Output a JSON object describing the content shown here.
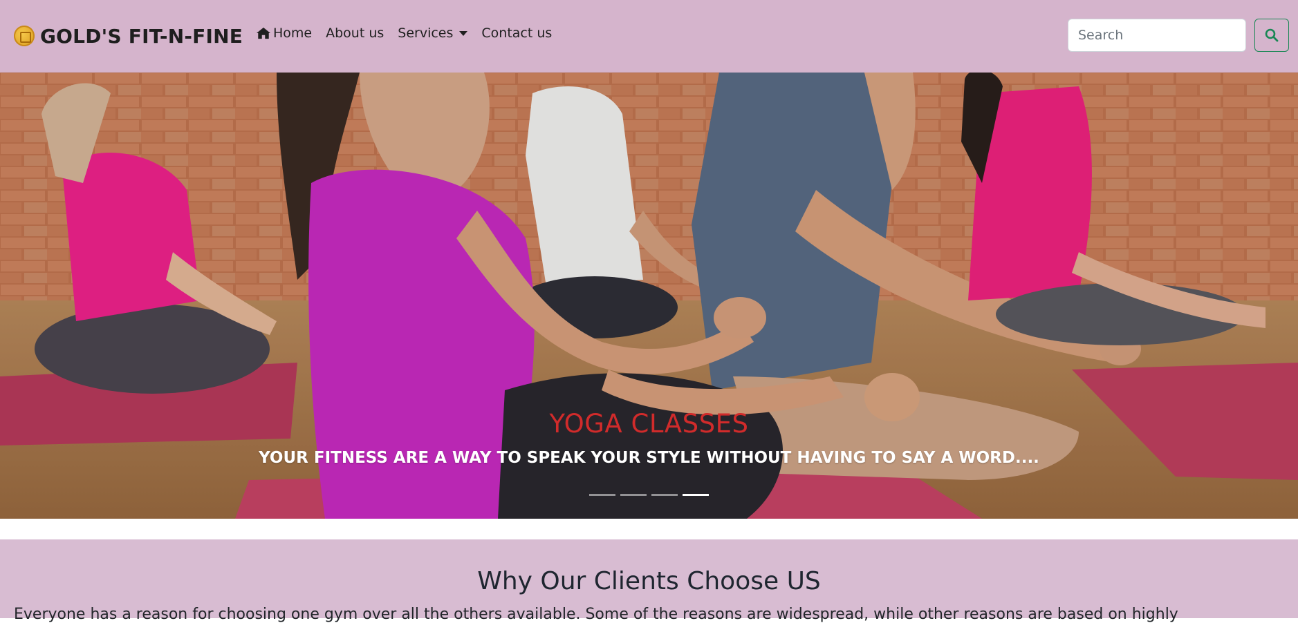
{
  "navbar": {
    "brand": "GOLD'S FIT-N-FINE",
    "brand_icon": "gold-coin-logo-icon",
    "links": {
      "home": "Home",
      "about": "About us",
      "services": "Services",
      "contact": "Contact us"
    },
    "search": {
      "placeholder": "Search",
      "button_icon": "search-icon"
    },
    "colors": {
      "background": "#d5b4cc",
      "search_button_border": "#198754"
    }
  },
  "carousel": {
    "caption_title": "YOGA CLASSES",
    "caption_text": "YOUR FITNESS ARE A WAY TO SPEAK YOUR STYLE WITHOUT HAVING TO SAY A WORD....",
    "slide_count": 4,
    "active_slide": 4,
    "colors": {
      "caption_title": "#d12b2b",
      "caption_text": "#ffffff"
    }
  },
  "why_section": {
    "title": "Why Our Clients Choose US",
    "text": "Everyone has a reason for choosing one gym over all the others available. Some of the reasons are widespread, while other reasons are based on highly",
    "colors": {
      "background": "#d8bcd2"
    }
  }
}
